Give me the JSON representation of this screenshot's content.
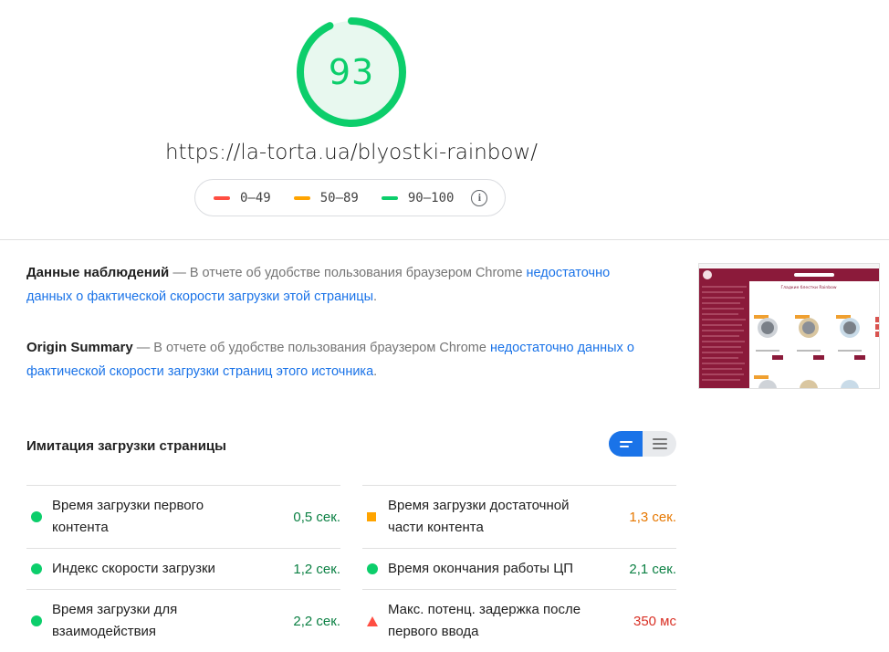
{
  "score": {
    "value": "93",
    "fraction": 0.93,
    "color": "#0cce6b"
  },
  "url": "https://la-torta.ua/blyostki-rainbow/",
  "legend": [
    {
      "label": "0–49",
      "color": "#ff4e42"
    },
    {
      "label": "50–89",
      "color": "#ffa400"
    },
    {
      "label": "90–100",
      "color": "#0cce6b"
    }
  ],
  "legend_info_icon": "info-icon",
  "field_data": {
    "title": "Данные наблюдений",
    "text": "— В отчете об удобстве пользования браузером Chrome",
    "link": "недостаточно данных о фактической скорости загрузки этой страницы",
    "suffix": "."
  },
  "origin_summary": {
    "title": "Origin Summary",
    "text": "— В отчете об удобстве пользования браузером Chrome",
    "link": "недостаточно данных о фактической скорости загрузки страниц этого источника",
    "suffix": "."
  },
  "thumbnail": {
    "heading": "Гладкие блестки Rainbow",
    "accent_color": "#8b1a3a"
  },
  "lab": {
    "title": "Имитация загрузки страницы",
    "toggle_icons": [
      "list-view-icon",
      "expanded-view-icon"
    ]
  },
  "metrics": {
    "left": [
      {
        "label": "Время загрузки первого контента",
        "value": "0,5 сек.",
        "status": "good"
      },
      {
        "label": "Индекс скорости загрузки",
        "value": "1,2 сек.",
        "status": "good"
      },
      {
        "label": "Время загрузки для взаимодействия",
        "value": "2,2 сек.",
        "status": "good"
      }
    ],
    "right": [
      {
        "label": "Время загрузки достаточной части контента",
        "value": "1,3 сек.",
        "status": "average"
      },
      {
        "label": "Время окончания работы ЦП",
        "value": "2,1 сек.",
        "status": "good"
      },
      {
        "label": "Макс. потенц. задержка после первого ввода",
        "value": "350 мс",
        "status": "bad"
      }
    ]
  },
  "status_colors": {
    "good": "#0cce6b",
    "average": "#ffa400",
    "bad": "#ff4e42"
  }
}
